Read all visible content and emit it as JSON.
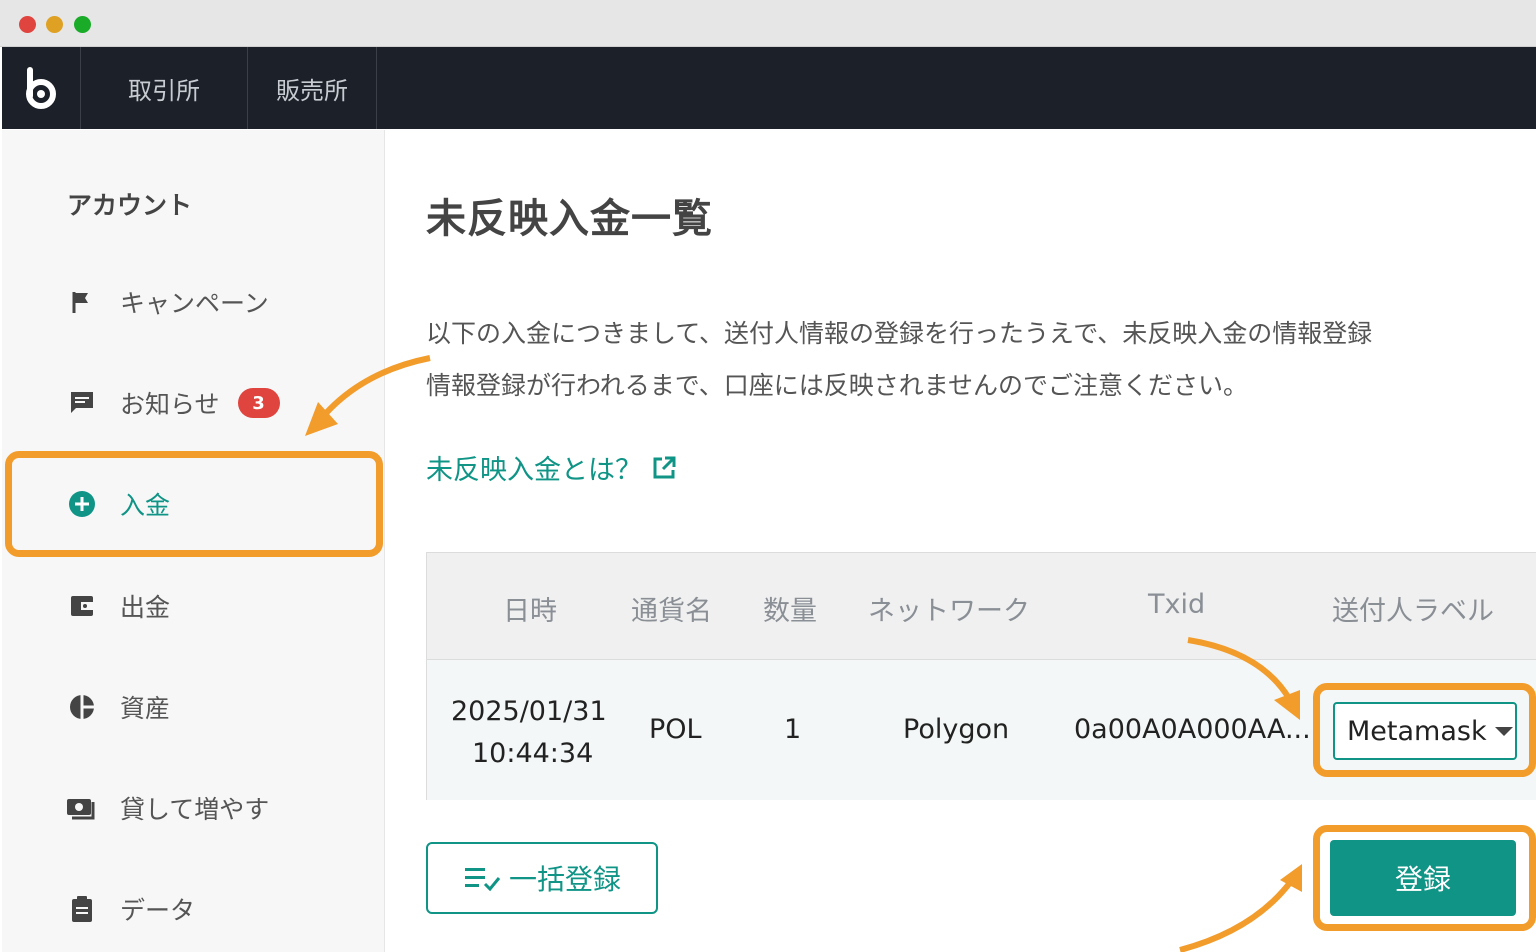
{
  "header": {
    "logo_icon": "brand-logo-icon",
    "nav": [
      {
        "label": "取引所"
      },
      {
        "label": "販売所"
      }
    ]
  },
  "sidebar": {
    "heading": "アカウント",
    "items": [
      {
        "label": "キャンペーン",
        "icon": "flag-icon"
      },
      {
        "label": "お知らせ",
        "icon": "message-icon",
        "badge": "3"
      },
      {
        "label": "入金",
        "icon": "plus-circle-icon",
        "active": true
      },
      {
        "label": "出金",
        "icon": "wallet-icon"
      },
      {
        "label": "資産",
        "icon": "pie-chart-icon"
      },
      {
        "label": "貸して増やす",
        "icon": "lend-icon"
      },
      {
        "label": "データ",
        "icon": "clipboard-icon"
      }
    ]
  },
  "main": {
    "title": "未反映入金一覧",
    "description_line1": "以下の入金につきまして、送付人情報の登録を行ったうえで、未反映入金の情報登録",
    "description_line2": "情報登録が行われるまで、口座には反映されませんのでご注意ください。",
    "info_link": "未反映入金とは？",
    "table": {
      "headers": [
        "日時",
        "通貨名",
        "数量",
        "ネットワーク",
        "Txid",
        "送付人ラベル"
      ],
      "rows": [
        {
          "date": "2025/01/31",
          "time": "10:44:34",
          "currency": "POL",
          "quantity": "1",
          "network": "Polygon",
          "txid": "0a00A0A000AA...",
          "sender_label": "Metamask"
        }
      ]
    },
    "bulk_button": "一括登録",
    "register_button": "登録"
  },
  "colors": {
    "accent": "#0f9486",
    "highlight": "#f29c2b",
    "topbar": "#1c2028",
    "badge": "#e0443e"
  }
}
